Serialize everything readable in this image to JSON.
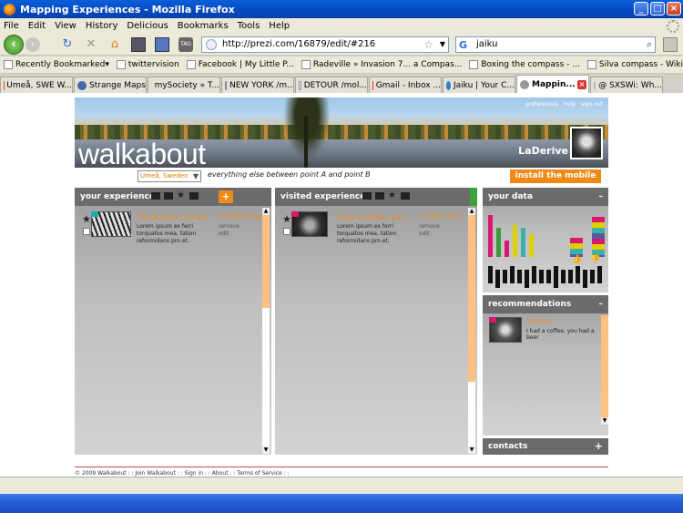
{
  "window": {
    "title": "Mapping Experiences - Mozilla Firefox"
  },
  "menu": [
    "File",
    "Edit",
    "View",
    "History",
    "Delicious",
    "Bookmarks",
    "Tools",
    "Help"
  ],
  "nav": {
    "url": "http://prezi.com/16879/edit/#216",
    "search_value": "jaiku",
    "tag_label": "TAG"
  },
  "bookmarks": [
    "Recently Bookmarked",
    "twittervision",
    "Facebook | My Little P...",
    "Radeville » Invasion 7... a Compas...",
    "Boxing the compass - ...",
    "Silva compass - Wikipe..."
  ],
  "tabs": [
    "Umeå, SWE W...",
    "Strange Maps",
    "mySociety » T...",
    "NEW YORK /m...",
    "DETOUR /mol...",
    "Gmail - Inbox ...",
    "Jaiku | Your C...",
    "Mappin...",
    "@ SXSWi: Wh..."
  ],
  "site": {
    "logo": "walkabout",
    "links": [
      "preferences",
      "help",
      "sign out"
    ],
    "username": "LaDerive",
    "city": "Umeå, Sweden",
    "tagline": "everything else between point A and point B",
    "mobile_button": "install the mobile app"
  },
  "your_experiences": {
    "title": "your experiences",
    "item": {
      "title": "Tim Burton's Forest",
      "date": "28 MAR 2008",
      "desc": "Lorem ipsum ex ferri torquatos mea, tation reformidans pro et.",
      "remove": "remove",
      "edit": "edit"
    },
    "scroll_position": 0.4
  },
  "visited_experiences": {
    "title": "visited experiences",
    "item": {
      "title": "I had a coffee, you...",
      "date": "11 NOV 2005",
      "desc": "Lorem ipsum ex ferri torquatos mea, tation reformidans pro et.",
      "remove": "remove",
      "edit": "edit"
    },
    "scroll_position": 0.72
  },
  "your_data": {
    "title": "your data",
    "collapse": "–",
    "bars": [
      {
        "value": 1.0,
        "color": "#d8186e"
      },
      {
        "value": 0.7,
        "color": "#3a9b3a"
      },
      {
        "value": 0.4,
        "color": "#d8186e"
      },
      {
        "value": 0.75,
        "color": "#e0d000"
      },
      {
        "value": 0.7,
        "color": "#3ab0a8"
      },
      {
        "value": 0.55,
        "color": "#e0d000"
      },
      {
        "value": 0.45,
        "color": "#d8186e"
      },
      {
        "value": 0.95,
        "color": "#5a5aa0"
      }
    ]
  },
  "recommendations": {
    "title": "recommendations",
    "collapse": "–",
    "item": {
      "name": "lisicolo",
      "text": "I had a coffee, you had a beer"
    }
  },
  "contacts": {
    "title": "contacts",
    "expand": "+"
  },
  "footer": "© 2009 Walkabout : : Join Walkabout : : Sign in : : About : : Terms of Service : :"
}
